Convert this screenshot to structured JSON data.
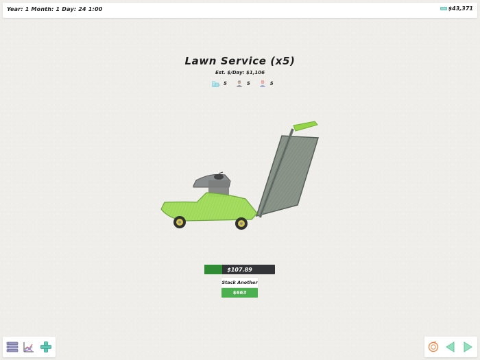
{
  "status_bar": {
    "date": "Year: 1 Month: 1 Day: 24 1:00",
    "money": "$43,371",
    "money_icon": "cash-icon"
  },
  "business": {
    "title": "Lawn Service (x5)",
    "estimate": "Est. $/Day: $1,106",
    "stats": [
      {
        "icon": "building-icon",
        "value": "5"
      },
      {
        "icon": "worker-icon",
        "value": "5"
      },
      {
        "icon": "manager-icon",
        "value": "5"
      }
    ]
  },
  "progress": {
    "label": "$107.89",
    "fraction": 0.25
  },
  "actions": {
    "stack_label": "Stack Another",
    "cost": "$663"
  },
  "toolbar_left": [
    {
      "name": "menu-icon"
    },
    {
      "name": "stats-chart-icon"
    },
    {
      "name": "add-icon"
    }
  ],
  "toolbar_right": [
    {
      "name": "refresh-icon"
    },
    {
      "name": "previous-icon"
    },
    {
      "name": "next-icon"
    }
  ],
  "colors": {
    "green": "#4caf50",
    "dark_green": "#2f8b34",
    "progress_bg": "#333437",
    "teal": "#7fcfc3",
    "purple": "#9a9ac1",
    "orange": "#ef8a4a"
  }
}
